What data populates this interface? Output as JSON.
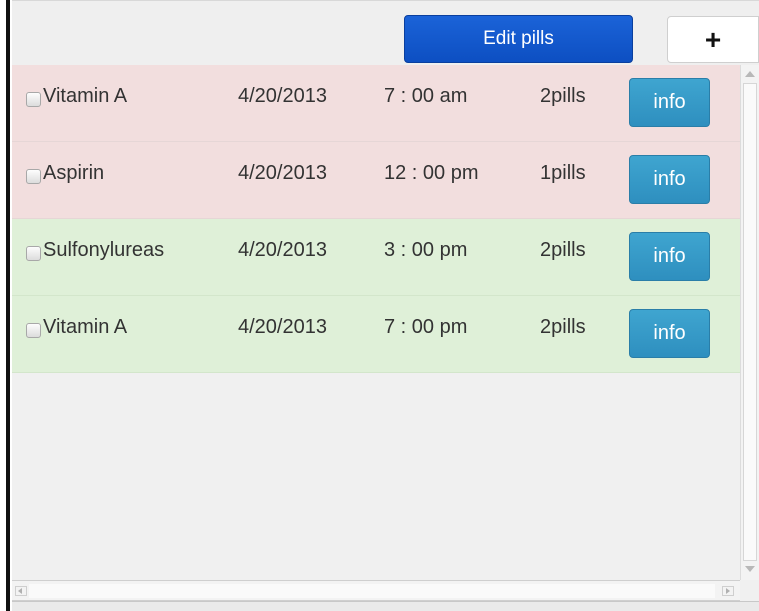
{
  "toolbar": {
    "edit_label": "Edit pills",
    "add_label": "+",
    "edit_color": "#0d56cf"
  },
  "rows": [
    {
      "name": "Vitamin A",
      "date": "4/20/2013",
      "time": "7 : 00 am",
      "qty": "2pills",
      "action": "info",
      "status": "red",
      "checked": false
    },
    {
      "name": "Aspirin",
      "date": "4/20/2013",
      "time": "12 : 00 pm",
      "qty": "1pills",
      "action": "info",
      "status": "red",
      "checked": false
    },
    {
      "name": "Sulfonylureas",
      "date": "4/20/2013",
      "time": "3 : 00 pm",
      "qty": "2pills",
      "action": "info",
      "status": "green",
      "checked": false
    },
    {
      "name": "Vitamin A",
      "date": "4/20/2013",
      "time": "7 : 00 pm",
      "qty": "2pills",
      "action": "info",
      "status": "green",
      "checked": false
    }
  ],
  "colors": {
    "row_red": "#f2dede",
    "row_green": "#dff0d8",
    "info_button": "#2e8fbf"
  },
  "icons": {
    "add": "plus-icon",
    "scroll_up": "chevron-up-icon",
    "scroll_down": "chevron-down-icon",
    "scroll_left": "chevron-left-icon",
    "scroll_right": "chevron-right-icon"
  }
}
